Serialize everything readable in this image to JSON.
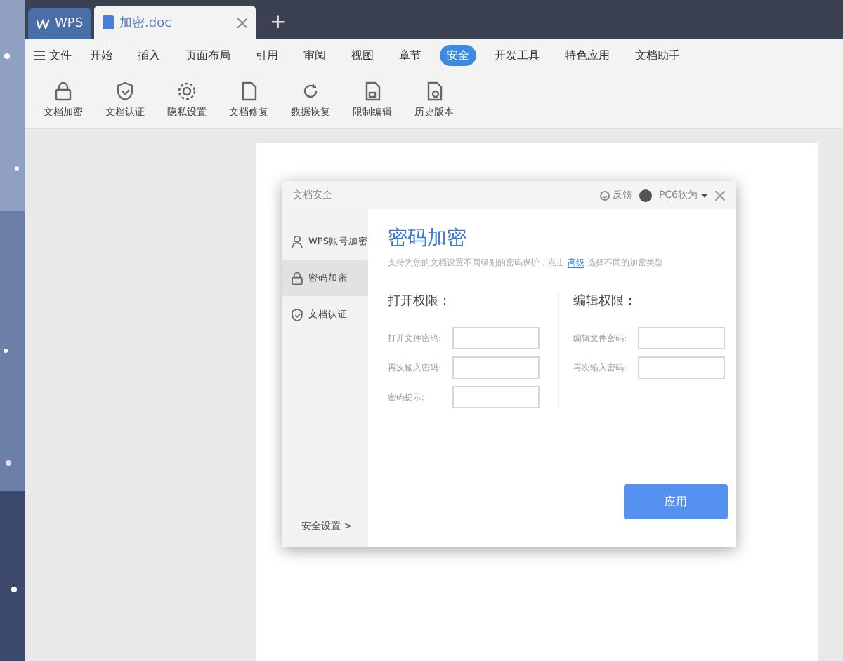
{
  "tabs": [
    {
      "label": "WPS",
      "kind": "home",
      "selected": false
    },
    {
      "label": "加密.doc",
      "kind": "doc",
      "selected": true
    }
  ],
  "new_tab": "+",
  "menu": {
    "file": "文件",
    "items": [
      {
        "label": "开始",
        "selected": false
      },
      {
        "label": "插入",
        "selected": false
      },
      {
        "label": "页面布局",
        "selected": false
      },
      {
        "label": "引用",
        "selected": false
      },
      {
        "label": "审阅",
        "selected": false
      },
      {
        "label": "视图",
        "selected": false
      },
      {
        "label": "章节",
        "selected": false
      },
      {
        "label": "安全",
        "selected": true
      },
      {
        "label": "开发工具",
        "selected": false
      },
      {
        "label": "特色应用",
        "selected": false
      },
      {
        "label": "文档助手",
        "selected": false
      }
    ]
  },
  "ribbon": [
    {
      "label": "文档加密",
      "kind": "lock"
    },
    {
      "label": "文档认证",
      "kind": "shield"
    },
    {
      "label": "隐私设置",
      "kind": "gear"
    },
    {
      "label": "文档修复",
      "kind": "doc"
    },
    {
      "label": "数据恢复",
      "kind": "restore"
    },
    {
      "label": "限制编辑",
      "kind": "lockdoc"
    },
    {
      "label": "历史版本",
      "kind": "clockdoc"
    }
  ],
  "dialog": {
    "title": "文档安全",
    "feedback": "反馈",
    "user": "PC6软为",
    "nav": [
      {
        "label": "WPS账号加密",
        "kind": "user",
        "selected": false
      },
      {
        "label": "密码加密",
        "kind": "lock",
        "selected": true
      },
      {
        "label": "文档认证",
        "kind": "shield",
        "selected": false
      }
    ],
    "settings_link": "安全设置 >",
    "heading": "密码加密",
    "description": "支持为您的文档设置不同级别的密码保护，点击 **高级** 选择不同的加密类型",
    "open": {
      "title": "打开权限：",
      "fields": [
        {
          "label": "打开文件密码:"
        },
        {
          "label": "再次输入密码:"
        },
        {
          "label": "密码提示:"
        }
      ]
    },
    "edit": {
      "title": "编辑权限：",
      "fields": [
        {
          "label": "编辑文件密码:"
        },
        {
          "label": "再次输入密码:"
        }
      ]
    },
    "apply": "应用"
  }
}
